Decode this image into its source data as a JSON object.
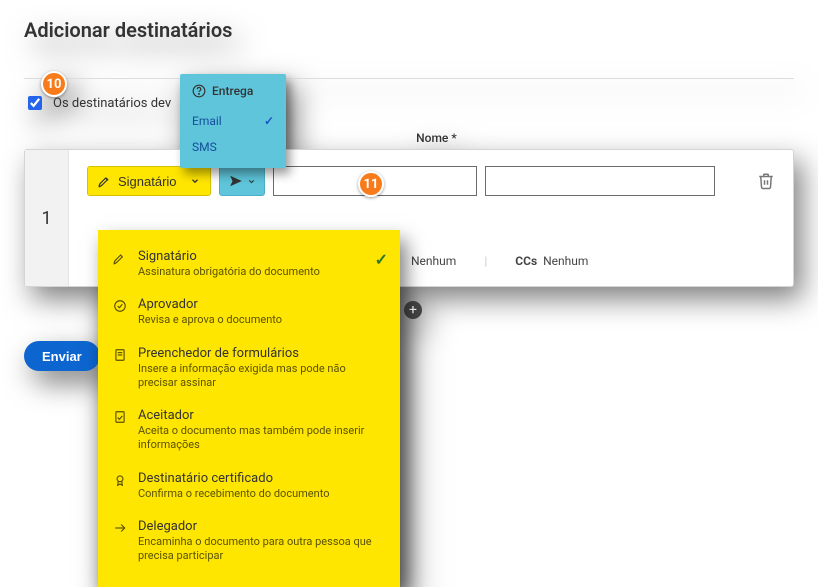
{
  "title": "Adicionar destinatários",
  "checkbox_label": "Os destinatários dev",
  "recipient": {
    "index": "1",
    "role_button_label": "Signatário",
    "email_label": "Email",
    "nome_label": "Nome",
    "required_mark": "*",
    "meta_none": "Nenhum",
    "meta_ccs": "CCs"
  },
  "send_label": "Enviar",
  "badges": {
    "b10": "10",
    "b11": "11"
  },
  "delivery": {
    "header": "Entrega",
    "options": [
      {
        "label": "Email",
        "selected": true
      },
      {
        "label": "SMS",
        "selected": false
      }
    ]
  },
  "roles": [
    {
      "title": "Signatário",
      "desc": "Assinatura obrigatória do documento",
      "selected": true
    },
    {
      "title": "Aprovador",
      "desc": "Revisa e aprova o documento",
      "selected": false
    },
    {
      "title": "Preenchedor de formulários",
      "desc": "Insere a informação exigida mas pode não precisar assinar",
      "selected": false
    },
    {
      "title": "Aceitador",
      "desc": "Aceita o documento mas também pode inserir informações",
      "selected": false
    },
    {
      "title": "Destinatário certificado",
      "desc": "Confirma o recebimento do documento",
      "selected": false
    },
    {
      "title": "Delegador",
      "desc": "Encaminha o documento para outra pessoa que precisa participar",
      "selected": false
    }
  ]
}
